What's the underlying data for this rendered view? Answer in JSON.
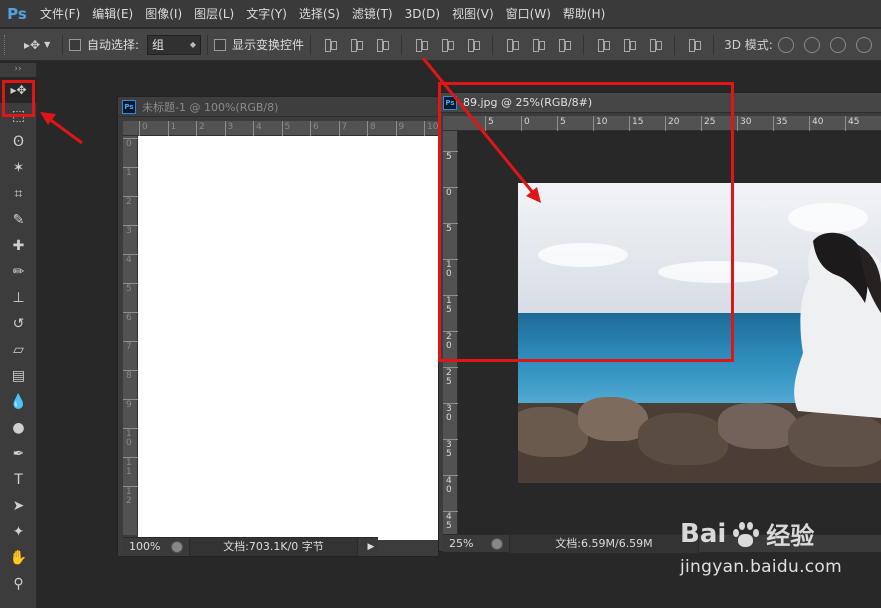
{
  "app": {
    "logo": "Ps"
  },
  "menu": [
    "文件(F)",
    "编辑(E)",
    "图像(I)",
    "图层(L)",
    "文字(Y)",
    "选择(S)",
    "滤镜(T)",
    "3D(D)",
    "视图(V)",
    "窗口(W)",
    "帮助(H)"
  ],
  "options": {
    "auto_select_label": "自动选择:",
    "auto_select_value": "组",
    "show_transform_label": "显示变换控件",
    "mode_3d_label": "3D 模式:"
  },
  "toolbox": {
    "grip": "››",
    "tools": [
      {
        "name": "move-tool",
        "glyph": "▸✥"
      },
      {
        "name": "marquee-tool",
        "glyph": "⬚"
      },
      {
        "name": "lasso-tool",
        "glyph": "ʘ"
      },
      {
        "name": "magic-wand-tool",
        "glyph": "✶"
      },
      {
        "name": "crop-tool",
        "glyph": "⌗"
      },
      {
        "name": "eyedropper-tool",
        "glyph": "✎"
      },
      {
        "name": "healing-brush-tool",
        "glyph": "✚"
      },
      {
        "name": "brush-tool",
        "glyph": "✏"
      },
      {
        "name": "clone-stamp-tool",
        "glyph": "⊥"
      },
      {
        "name": "history-brush-tool",
        "glyph": "↺"
      },
      {
        "name": "eraser-tool",
        "glyph": "▱"
      },
      {
        "name": "gradient-tool",
        "glyph": "▤"
      },
      {
        "name": "blur-tool",
        "glyph": "💧"
      },
      {
        "name": "dodge-tool",
        "glyph": "●"
      },
      {
        "name": "pen-tool",
        "glyph": "✒"
      },
      {
        "name": "type-tool",
        "glyph": "T"
      },
      {
        "name": "path-selection-tool",
        "glyph": "➤"
      },
      {
        "name": "shape-tool",
        "glyph": "✦"
      },
      {
        "name": "hand-tool",
        "glyph": "✋"
      },
      {
        "name": "zoom-tool",
        "glyph": "⚲"
      }
    ]
  },
  "doc1": {
    "title": "未标题-1 @ 100%(RGB/8)",
    "ruler_h": [
      "0",
      "1",
      "2",
      "3",
      "4",
      "5",
      "6",
      "7",
      "8",
      "9",
      "10"
    ],
    "ruler_v": [
      "0",
      "1",
      "2",
      "3",
      "4",
      "5",
      "6",
      "7",
      "8",
      "9",
      "10",
      "11",
      "12"
    ],
    "zoom": "100%",
    "doc_info": "文档:703.1K/0 字节"
  },
  "doc2": {
    "title": "89.jpg @ 25%(RGB/8#)",
    "ruler_h": [
      "5",
      "0",
      "5",
      "10",
      "15",
      "20",
      "25",
      "30",
      "35",
      "40",
      "45"
    ],
    "ruler_v": [
      "5",
      "0",
      "5",
      "10",
      "15",
      "20",
      "25",
      "30",
      "35",
      "40",
      "45"
    ],
    "zoom": "25%",
    "doc_info": "文档:6.59M/6.59M"
  },
  "watermark": {
    "brand": "Bai",
    "brand_cn": "经验",
    "url": "jingyan.baidu.com"
  },
  "colors": {
    "annotation_red": "#e01515",
    "ps_blue": "#4fa3e0"
  }
}
